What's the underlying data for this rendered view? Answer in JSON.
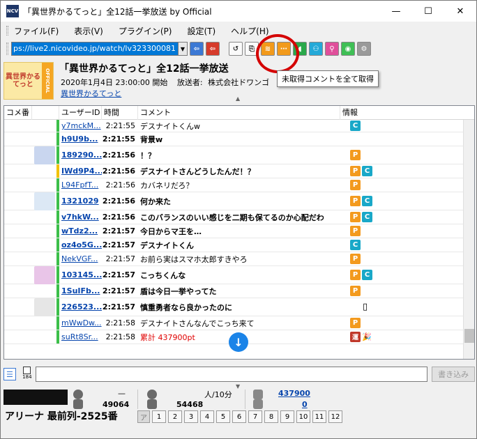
{
  "window": {
    "title": "「異世界かるてっと」全12話一挙放送 by Official",
    "icon_label": "NCV",
    "controls": [
      "—",
      "☐",
      "✕"
    ]
  },
  "menu": [
    "ファイル(F)",
    "表示(V)",
    "プラグイン(P)",
    "設定(T)",
    "ヘルプ(H)"
  ],
  "toolbar": {
    "url": "ps://live2.nicovideo.jp/watch/lv323300081",
    "tooltip": "未取得コメントを全て取得"
  },
  "program": {
    "thumb_text": "異世界かるてっと",
    "thumb_side": "OFFICIAL",
    "title": "「異世界かるてっと」全12話一挙放送",
    "date": "2020年1月4日 23:00:00 開始",
    "broadcaster_label": "放送者:",
    "broadcaster": "株式会社ドワンゴ",
    "link": "異世界かるてっと"
  },
  "columns": [
    "コメ番",
    "",
    "ユーザーID",
    "時間",
    "コメント",
    "情報"
  ],
  "rows": [
    {
      "uid": "y7mckM...",
      "time": "2:21:55",
      "comment": "デスナイトくんw",
      "bold": false,
      "bar": "#3cbf4a",
      "badges": [
        "C"
      ],
      "avatar": ""
    },
    {
      "uid": "h9U9b...",
      "time": "2:21:55",
      "comment": "背景w",
      "bold": true,
      "bar": "#3cbf4a",
      "badges": [],
      "avatar": ""
    },
    {
      "uid": "189290...",
      "time": "2:21:56",
      "comment": "！？",
      "bold": true,
      "bar": "#3cbf4a",
      "badges": [
        "P"
      ],
      "avatar": "a1"
    },
    {
      "uid": "IWd9P4...",
      "time": "2:21:56",
      "comment": "デスナイトさんどうしたんだ！？",
      "bold": true,
      "bar": "#f2c200",
      "badges": [
        "P",
        "C"
      ],
      "avatar": ""
    },
    {
      "uid": "L94FpfT...",
      "time": "2:21:56",
      "comment": "カバネリだろ？",
      "bold": false,
      "bar": "#3cbf4a",
      "badges": [
        "P"
      ],
      "avatar": ""
    },
    {
      "uid": "1321029",
      "time": "2:21:56",
      "comment": "何か来た",
      "bold": true,
      "bar": "#3cbf4a",
      "badges": [
        "P",
        "C"
      ],
      "avatar": "a2"
    },
    {
      "uid": "v7hkW...",
      "time": "2:21:56",
      "comment": "このバランスのいい感じを二期も保てるのか心配だわ",
      "bold": true,
      "bar": "#3cbf4a",
      "badges": [
        "P",
        "C"
      ],
      "avatar": ""
    },
    {
      "uid": "wTdz2...",
      "time": "2:21:57",
      "comment": "今日からマ王を…",
      "bold": true,
      "bar": "#3cbf4a",
      "badges": [
        "P"
      ],
      "avatar": ""
    },
    {
      "uid": "oz4o5G...",
      "time": "2:21:57",
      "comment": "デスナイトくん",
      "bold": true,
      "bar": "#3cbf4a",
      "badges": [
        "C"
      ],
      "avatar": ""
    },
    {
      "uid": "NekVGF...",
      "time": "2:21:57",
      "comment": "お前ら実はスマホ太郎すきやろ",
      "bold": false,
      "bar": "#3cbf4a",
      "badges": [
        "P"
      ],
      "avatar": ""
    },
    {
      "uid": "103145...",
      "time": "2:21:57",
      "comment": "こっちくんな",
      "bold": true,
      "bar": "#3cbf4a",
      "badges": [
        "P",
        "C"
      ],
      "avatar": "a3"
    },
    {
      "uid": "1SuIFb...",
      "time": "2:21:57",
      "comment": "盾は今日一挙やってた",
      "bold": true,
      "bar": "#3cbf4a",
      "badges": [
        "P"
      ],
      "avatar": ""
    },
    {
      "uid": "226523...",
      "time": "2:21:57",
      "comment": "慎重勇者なら良かったのに",
      "bold": true,
      "bar": "#3cbf4a",
      "badges": [
        "phone"
      ],
      "avatar": "a4"
    },
    {
      "uid": "mWwDw...",
      "time": "2:21:58",
      "comment": "デスナイトさんなんでこっち来て",
      "bold": false,
      "bar": "#3cbf4a",
      "badges": [
        "P"
      ],
      "avatar": ""
    },
    {
      "uid": "suRt8Sr...",
      "time": "2:21:58",
      "comment": "累計 437900pt",
      "bold": false,
      "bar": "#3cbf4a",
      "badges": [
        "運",
        "party"
      ],
      "avatar": "",
      "red": true
    }
  ],
  "input": {
    "checkbox_label": "184",
    "send_label": "書き込み"
  },
  "stats": {
    "comments_top": "—",
    "comments": "49064",
    "viewers": "54468",
    "per10": "人/10分",
    "ad_points": "437900",
    "gift_points": "0"
  },
  "seat": "アリーナ 最前列-2525番",
  "num_buttons": [
    "ア",
    "1",
    "2",
    "3",
    "4",
    "5",
    "6",
    "7",
    "8",
    "9",
    "10",
    "11",
    "12"
  ]
}
